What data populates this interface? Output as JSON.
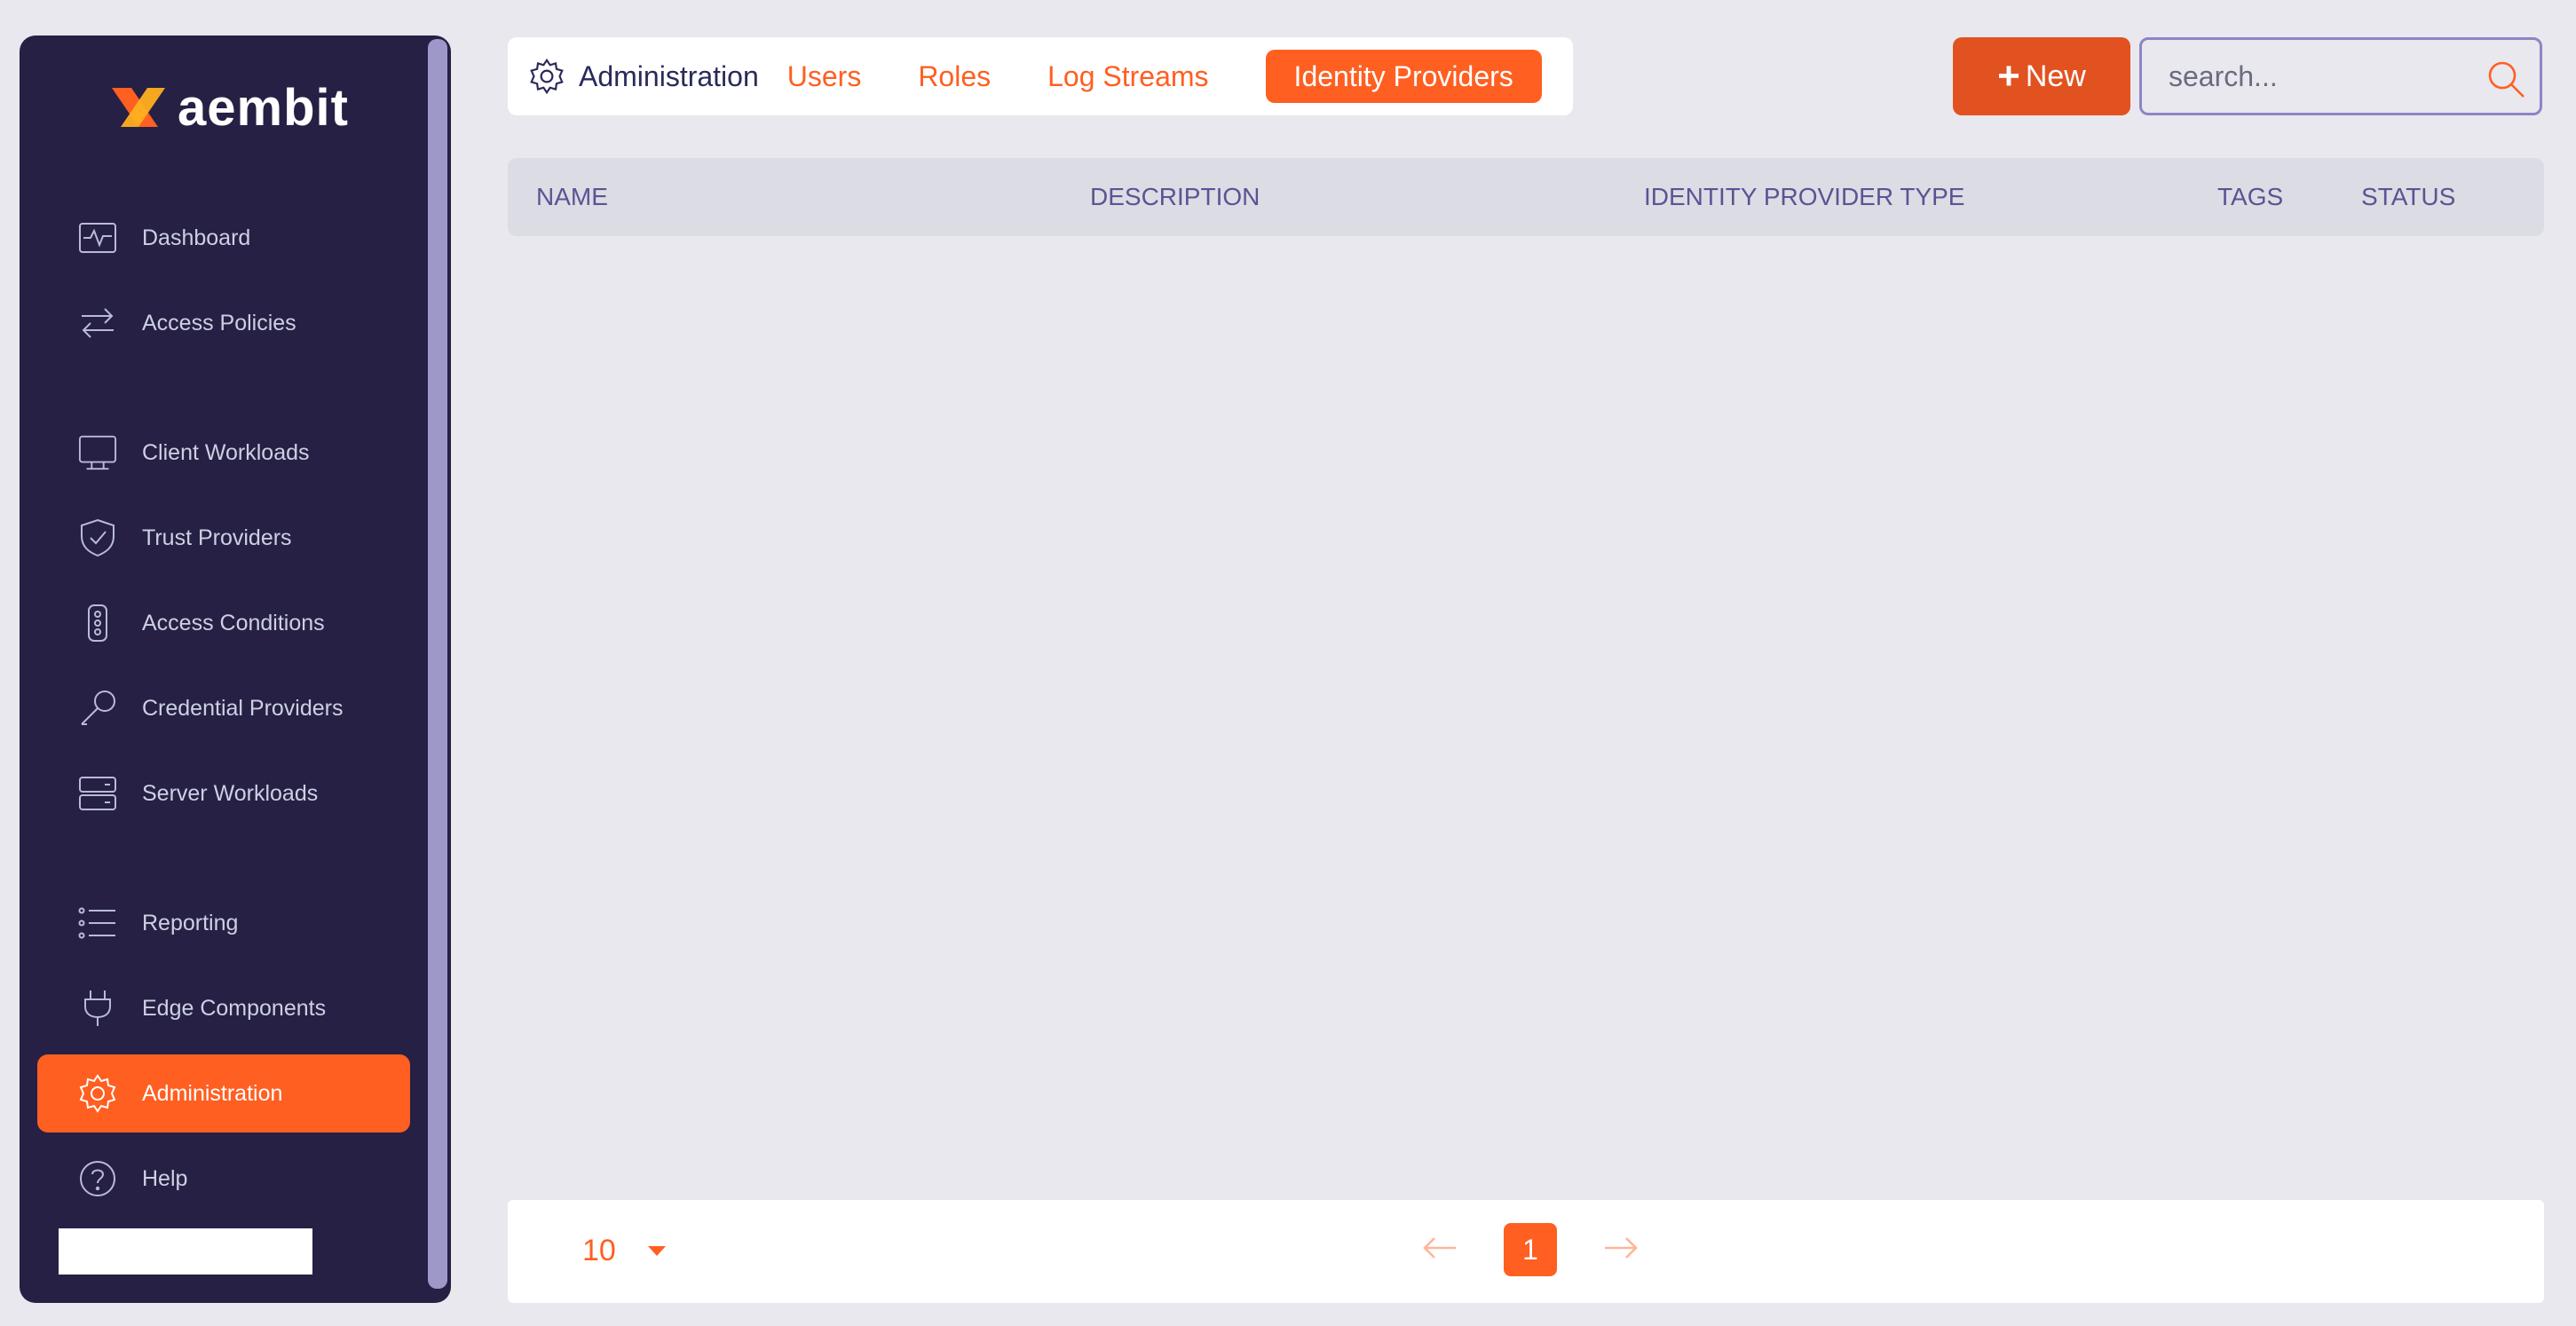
{
  "app": {
    "logo_text": "aembit"
  },
  "sidebar": {
    "items": [
      {
        "label": "Dashboard",
        "icon": "dashboard-icon"
      },
      {
        "label": "Access Policies",
        "icon": "swap-icon"
      },
      {
        "label": "Client Workloads",
        "icon": "monitor-icon"
      },
      {
        "label": "Trust Providers",
        "icon": "shield-check-icon"
      },
      {
        "label": "Access Conditions",
        "icon": "traffic-light-icon"
      },
      {
        "label": "Credential Providers",
        "icon": "key-icon"
      },
      {
        "label": "Server Workloads",
        "icon": "server-icon"
      },
      {
        "label": "Reporting",
        "icon": "list-icon"
      },
      {
        "label": "Edge Components",
        "icon": "plug-icon"
      },
      {
        "label": "Administration",
        "icon": "gear-icon",
        "active": true
      },
      {
        "label": "Help",
        "icon": "help-icon"
      }
    ]
  },
  "header": {
    "section_title": "Administration",
    "tabs": [
      {
        "label": "Users"
      },
      {
        "label": "Roles"
      },
      {
        "label": "Log Streams"
      },
      {
        "label": "Identity Providers",
        "active": true
      }
    ],
    "new_button_label": "New",
    "search_placeholder": "search..."
  },
  "table": {
    "columns": [
      "NAME",
      "DESCRIPTION",
      "IDENTITY PROVIDER TYPE",
      "TAGS",
      "STATUS"
    ],
    "rows": []
  },
  "footer": {
    "page_size": "10",
    "current_page": "1"
  },
  "colors": {
    "accent": "#ff5f21",
    "sidebar_bg": "#262044",
    "header_text": "#5a5394"
  }
}
